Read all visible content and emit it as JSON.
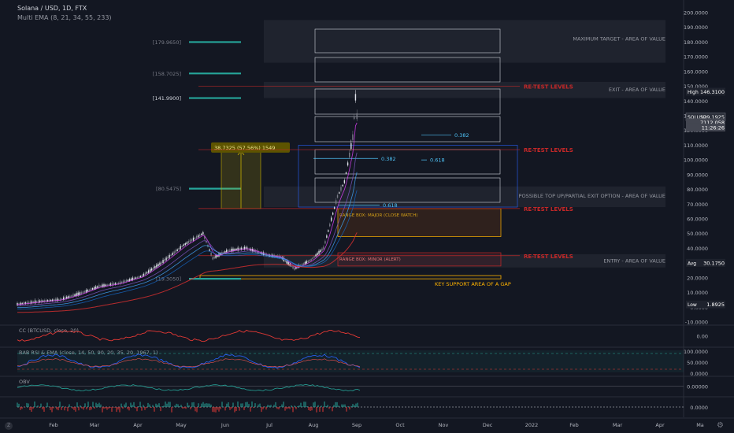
{
  "header": {
    "symbol": "Solana / USD, 1D, FTX",
    "indicator": "Multi EMA (8, 21, 34, 55, 233)"
  },
  "colors": {
    "background": "#131722",
    "bull": "#e0e3eb",
    "bear": "#787b86",
    "ema": [
      "#e040fb",
      "#7e57c2",
      "#42a5f5",
      "#1565c0",
      "#d32f2f"
    ],
    "retest": "#c62828",
    "support": "#ffb300",
    "measure": "#c9b100",
    "fib": "#26a69a",
    "fib_line": "#4fc3f7",
    "axis_text": "#b2b5be"
  },
  "chart_data": {
    "type": "candlestick",
    "symbol": "Solana / USD",
    "interval": "1D",
    "exchange": "FTX",
    "ylim": [
      -10,
      200
    ],
    "grid": false,
    "y_ticks": [
      "200.0000",
      "190.0000",
      "180.0000",
      "170.0000",
      "160.0000",
      "150.0000",
      "140.0000",
      "130.0000",
      "120.0000",
      "110.0000",
      "100.0000",
      "90.0000",
      "80.0000",
      "70.0000",
      "60.0000",
      "50.0000",
      "40.0000",
      "30.0000",
      "20.0000",
      "10.0000",
      "0.0000",
      "-10.0000"
    ],
    "x_ticks": [
      "Feb",
      "Mar",
      "Apr",
      "May",
      "Jun",
      "Jul",
      "Aug",
      "Sep",
      "Oct",
      "Nov",
      "Dec",
      "2022",
      "Feb",
      "Mar",
      "Apr",
      "Ma"
    ],
    "price_path": [
      [
        "2021-01-01",
        1.9
      ],
      [
        "2021-01-15",
        3.5
      ],
      [
        "2021-02-01",
        5
      ],
      [
        "2021-02-15",
        9
      ],
      [
        "2021-03-01",
        14
      ],
      [
        "2021-03-15",
        16
      ],
      [
        "2021-04-01",
        21
      ],
      [
        "2021-04-15",
        30
      ],
      [
        "2021-05-01",
        42
      ],
      [
        "2021-05-15",
        50
      ],
      [
        "2021-05-22",
        33
      ],
      [
        "2021-06-01",
        38
      ],
      [
        "2021-06-15",
        40
      ],
      [
        "2021-07-01",
        35
      ],
      [
        "2021-07-10",
        34
      ],
      [
        "2021-07-20",
        26
      ],
      [
        "2021-08-01",
        32
      ],
      [
        "2021-08-10",
        40
      ],
      [
        "2021-08-20",
        75
      ],
      [
        "2021-08-25",
        85
      ],
      [
        "2021-08-31",
        115
      ],
      [
        "2021-09-02",
        142
      ],
      [
        "2021-09-03",
        129.19
      ]
    ],
    "fib_levels": [
      {
        "label": "0.382",
        "price": 117
      },
      {
        "label": "0.382",
        "price": 101
      },
      {
        "label": "0.618",
        "price": 100
      },
      {
        "label": "0.618",
        "price": 69.4
      }
    ],
    "target_levels": [
      {
        "label": "[179.9650]",
        "price": 180
      },
      {
        "label": "[158.7025]",
        "price": 158.7
      },
      {
        "label": "[141.9900]",
        "price": 142
      },
      {
        "label": "[80.5475]",
        "price": 80.5
      },
      {
        "label": "[19.3050]",
        "price": 19.3
      }
    ],
    "measure": {
      "label": "38.7325 (57.56%) 1549",
      "from": 67,
      "to": 106
    },
    "retest_levels": [
      {
        "label": "RE-TEST LEVELS",
        "price": 150
      },
      {
        "label": "RE-TEST LEVELS",
        "price": 107
      },
      {
        "label": "RE-TEST LEVELS",
        "price": 67
      },
      {
        "label": "RE-TEST LEVELS",
        "price": 35
      }
    ],
    "zones": [
      {
        "label": "MAXIMUM TARGET - AREA OF VALUE",
        "from": 166,
        "to": 195
      },
      {
        "label": "EXIT - AREA OF VALUE",
        "from": 142,
        "to": 153
      },
      {
        "label": "POSSIBLE TOP UP/PARTIAL EXIT OPTION - AREA OF VALUE",
        "from": 68,
        "to": 82
      },
      {
        "label": "ENTRY - AREA OF VALUE",
        "from": 27,
        "to": 36
      },
      {
        "label": "KEY SUPPORT AREA OF A GAP",
        "from": 19.3,
        "to": 21.5
      }
    ],
    "ranges": [
      {
        "label": "RANGE BOX: MAJOR (CLOSE WATCH)",
        "from": 48,
        "to": 67
      },
      {
        "label": "RANGE BOX: MINOR (ALERT)",
        "from": 28,
        "to": 37
      }
    ],
    "price_tags": [
      {
        "name": "High",
        "value": "146.3100",
        "price": 146.31
      },
      {
        "name": "SOLUSD",
        "value": "129.1925",
        "price": 129.19
      },
      {
        "name": "",
        "value": "7112.058",
        "price": 125.5
      },
      {
        "name": "",
        "value": "11:26:26",
        "price": 122
      },
      {
        "name": "Avg",
        "value": "30.1750",
        "price": 30.175
      },
      {
        "name": "Low",
        "value": "1.8925",
        "price": 1.89
      }
    ],
    "subpanes": [
      {
        "name": "CC (BTCUSD, close, 20)",
        "ticks": [
          "0.00"
        ]
      },
      {
        "name": "BAB RSI & EMA (close, 14, 50, 90, 20, 35, 20, 1967, 1)",
        "ticks": [
          "100.0000",
          "50.0000",
          "0.0000"
        ]
      },
      {
        "name": "OBV",
        "ticks": [
          "0.00000"
        ]
      },
      {
        "name": "",
        "ticks": [
          "0.0000"
        ]
      }
    ]
  }
}
